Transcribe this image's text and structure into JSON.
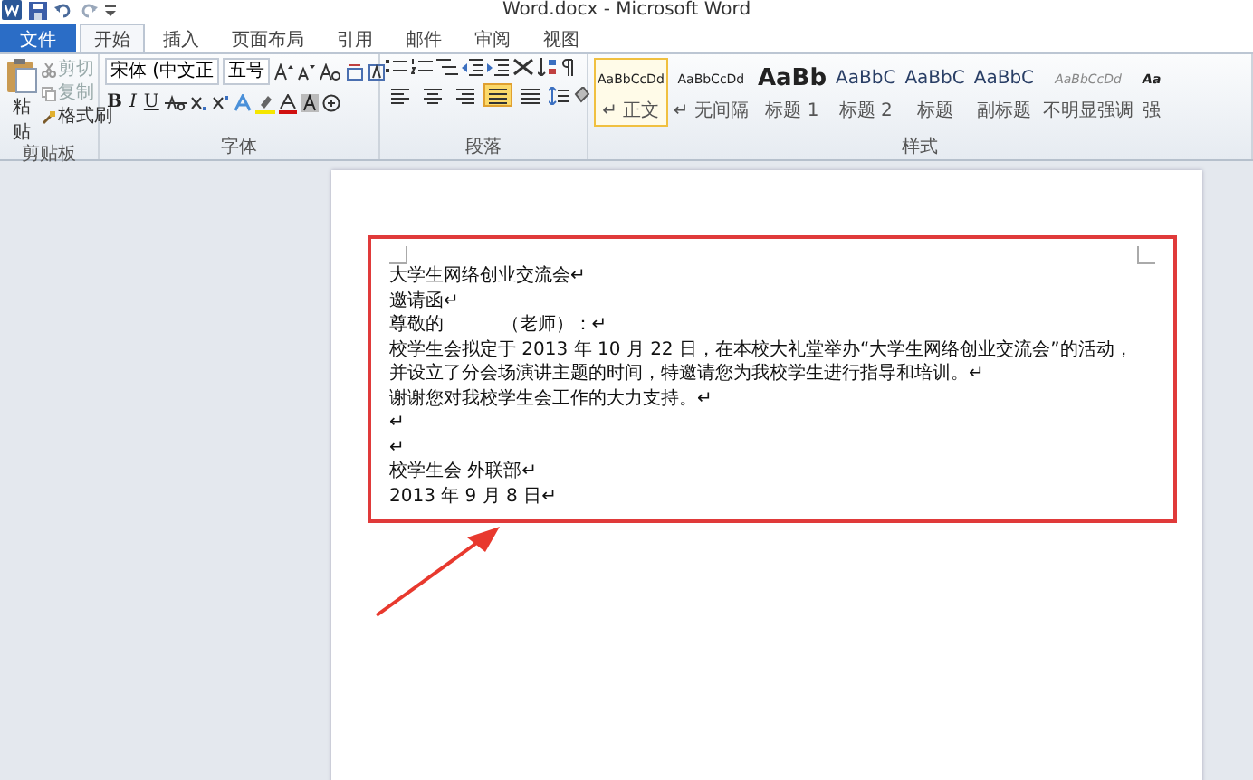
{
  "window": {
    "title": "Word.docx - Microsoft Word"
  },
  "tabs": [
    {
      "label": "文件",
      "kind": "file",
      "selected": false
    },
    {
      "label": "开始",
      "kind": "tab",
      "selected": true
    },
    {
      "label": "插入",
      "kind": "tab",
      "selected": false
    },
    {
      "label": "页面布局",
      "kind": "tab",
      "selected": false
    },
    {
      "label": "引用",
      "kind": "tab",
      "selected": false
    },
    {
      "label": "邮件",
      "kind": "tab",
      "selected": false
    },
    {
      "label": "审阅",
      "kind": "tab",
      "selected": false
    },
    {
      "label": "视图",
      "kind": "tab",
      "selected": false
    }
  ],
  "clipboard_group": {
    "title": "剪贴板",
    "paste": "粘贴",
    "cut": "剪切",
    "copy": "复制",
    "format_painter": "格式刷"
  },
  "font_group": {
    "title": "字体",
    "font_name": "宋体 (中文正",
    "font_size": "五号",
    "bold": "B",
    "italic": "I",
    "underline": "U"
  },
  "paragraph_group": {
    "title": "段落",
    "alignments": [
      {
        "kind": "left",
        "selected": false
      },
      {
        "kind": "center",
        "selected": false
      },
      {
        "kind": "right",
        "selected": false
      },
      {
        "kind": "justify",
        "selected": true
      },
      {
        "kind": "distributed",
        "selected": false
      }
    ]
  },
  "styles_group": {
    "title": "样式",
    "styles": [
      {
        "sample": "AaBbCcDd",
        "label": "↵ 正文",
        "kind": "normal",
        "selected": true
      },
      {
        "sample": "AaBbCcDd",
        "label": "↵ 无间隔",
        "kind": "normal",
        "selected": false
      },
      {
        "sample": "AaBb",
        "label": "标题 1",
        "kind": "heading1",
        "selected": false
      },
      {
        "sample": "AaBbC",
        "label": "标题 2",
        "kind": "heading2",
        "selected": false
      },
      {
        "sample": "AaBbC",
        "label": "标题",
        "kind": "heading2",
        "selected": false
      },
      {
        "sample": "AaBbC",
        "label": "副标题",
        "kind": "heading2",
        "selected": false
      },
      {
        "sample": "AaBbCcDd",
        "label": "不明显强调",
        "kind": "emphasis",
        "selected": false
      },
      {
        "sample": "Aa",
        "label": "强",
        "kind": "strong",
        "selected": false
      }
    ]
  },
  "document": {
    "lines": [
      "大学生网络创业交流会↵",
      "邀请函↵",
      "尊敬的          （老师）：↵",
      "校学生会拟定于 2013 年 10 月 22 日，在本校大礼堂举办“大学生网络创业交流会”的活动，",
      "并设立了分会场演讲主题的时间，特邀请您为我校学生进行指导和培训。↵",
      "谢谢您对我校学生会工作的大力支持。↵",
      "↵",
      "↵",
      "校学生会 外联部↵",
      "2013 年 9 月 8 日↵"
    ]
  }
}
